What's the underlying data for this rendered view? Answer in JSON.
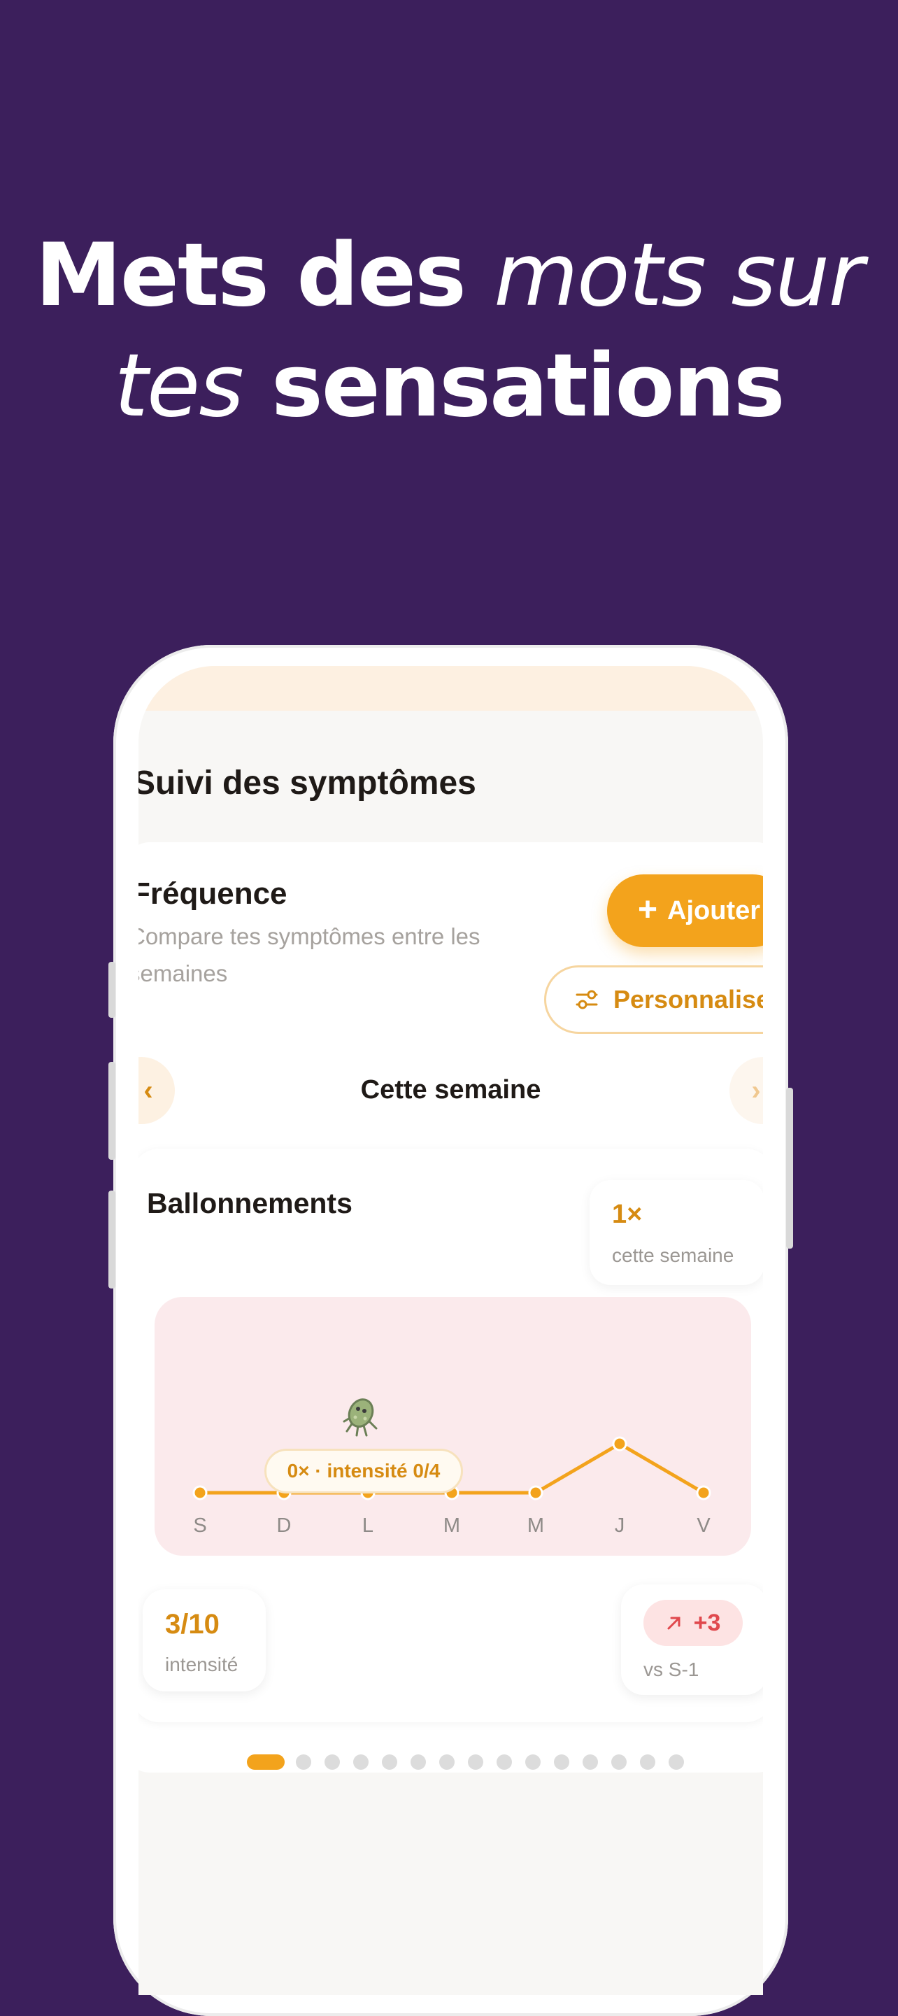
{
  "headline": {
    "part1": "Mets des",
    "part2_italic": "mots sur",
    "part3_italic": "tes",
    "part4": "sensations"
  },
  "screen": {
    "title": "Suivi des symptômes",
    "section_title": "Fréquence",
    "section_desc": "Compare tes symptômes entre les semaines",
    "add_button": "Ajouter",
    "customize_button": "Personnaliser",
    "week_label": "Cette semaine",
    "symptom": {
      "name": "Ballonnements",
      "count": "1×",
      "count_label": "cette semaine",
      "tooltip": "0× · intensité 0/4",
      "intensity_value": "3/10",
      "intensity_label": "intensité",
      "delta_value": "+3",
      "delta_label": "vs S-1"
    },
    "pager": {
      "total": 15,
      "active": 0
    }
  },
  "chart_data": {
    "type": "line",
    "categories": [
      "S",
      "D",
      "L",
      "M",
      "M",
      "J",
      "V"
    ],
    "values": [
      0,
      0,
      0,
      0,
      0,
      1,
      0
    ],
    "ylim": [
      0,
      2
    ],
    "grid": false,
    "highlight_index": 2
  },
  "colors": {
    "background": "#3c1f5c",
    "accent": "#f3a31c",
    "accent_text": "#d68b12",
    "chart_bg": "#fbeaec",
    "delta_red": "#e0484d"
  },
  "icons": {
    "add": "plus-icon",
    "customize": "sliders-icon",
    "prev": "chevron-left-icon",
    "next": "chevron-right-icon",
    "delta": "arrow-up-right-icon",
    "mascot": "bacteria-mascot-icon"
  }
}
